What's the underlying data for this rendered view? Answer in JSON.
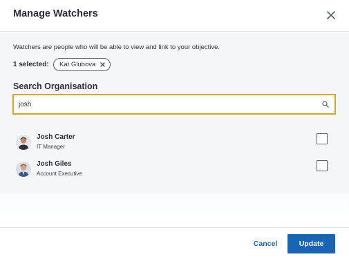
{
  "dialog": {
    "title": "Manage Watchers",
    "close_icon": "close-icon"
  },
  "body": {
    "description": "Watchers are people who will be able to view and link to your objective.",
    "selected_label": "1 selected:",
    "selected_chips": [
      {
        "label": "Kat Glubova",
        "remove_icon": "close-icon"
      }
    ]
  },
  "search": {
    "heading": "Search Organisation",
    "value": "josh",
    "icon": "search-icon",
    "focus_color": "#d6a52b"
  },
  "results": [
    {
      "name": "Josh Carter",
      "role": "IT Manager",
      "checked": false,
      "avatar_icon": "avatar"
    },
    {
      "name": "Josh Giles",
      "role": "Account Executive",
      "checked": false,
      "avatar_icon": "avatar"
    }
  ],
  "footer": {
    "cancel_label": "Cancel",
    "update_label": "Update",
    "accent_color": "#1a64b4"
  }
}
